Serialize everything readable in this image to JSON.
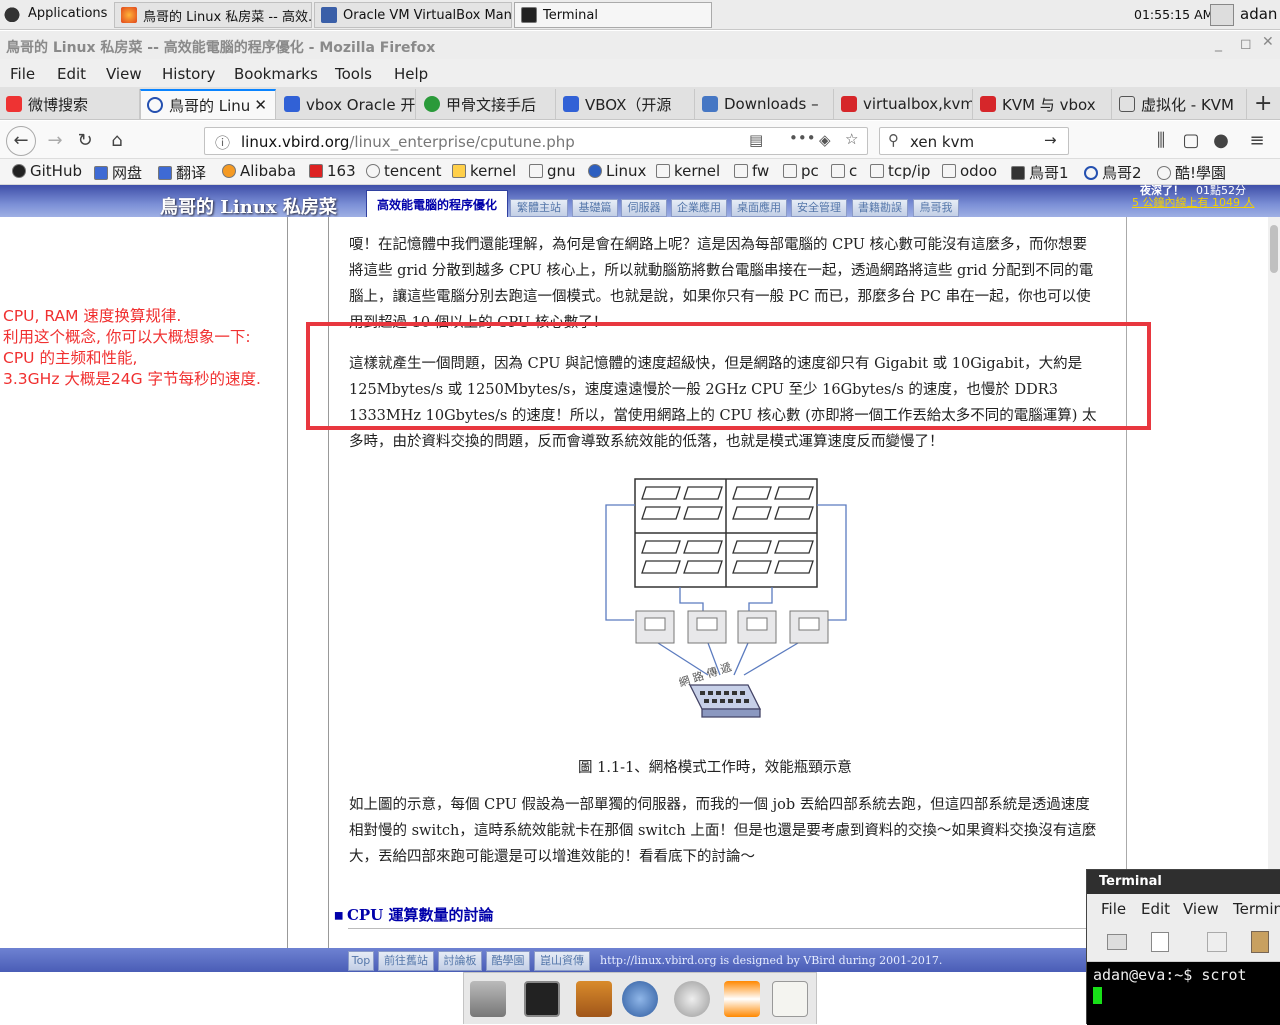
{
  "panel": {
    "apps_label": "Applications",
    "tasks": [
      "鳥哥的 Linux 私房菜 -- 高效...",
      "Oracle VM VirtualBox Mana...",
      "Terminal"
    ],
    "clock": "01:55:15 AM",
    "user": "adan"
  },
  "firefox": {
    "title": "鳥哥的 Linux 私房菜 -- 高效能電腦的程序優化 - Mozilla Firefox",
    "menu": [
      "File",
      "Edit",
      "View",
      "History",
      "Bookmarks",
      "Tools",
      "Help"
    ],
    "tabs": [
      "微博搜索",
      "鳥哥的 Linu",
      "vbox Oracle 开",
      "甲骨文接手后",
      "VBOX（开源",
      "Downloads –",
      "virtualbox,kvm",
      "KVM 与 vbox",
      "虚拟化 - KVM"
    ],
    "url_host": "linux.vbird.org",
    "url_path": "/linux_enterprise/cputune.php",
    "search_value": "xen kvm",
    "bookmarks": [
      "GitHub",
      "网盘",
      "翻译",
      "Alibaba",
      "163",
      "tencent",
      "kernel",
      "gnu",
      "Linux",
      "kernel",
      "fw",
      "pc",
      "c",
      "tcp/ip",
      "odoo",
      "鳥哥1",
      "鳥哥2",
      "酷!學園"
    ]
  },
  "site": {
    "title": "鳥哥的 Linux 私房菜",
    "active_tab": "高效能電腦的程序優化",
    "tabs": [
      "繁體主站",
      "基礎篇",
      "伺服器",
      "企業應用",
      "桌面應用",
      "安全管理",
      "書籍勘誤",
      "鳥哥我"
    ],
    "clock_line1": "夜深了！",
    "clock_time": "01點52分",
    "clock_line2": "5 公鐘內線上有 1049 人",
    "para1": "嗄！在記憶體中我們還能理解，為何是會在網路上呢？這是因為每部電腦的 CPU 核心數可能沒有這麼多，而你想要將這些 grid 分散到越多 CPU 核心上，所以就動腦筋將數台電腦串接在一起，透過網路將這些 grid 分配到不同的電腦上，讓這些電腦分別去跑這一個模式。也就是說，如果你只有一般 PC 而已，那麼多台 PC 串在一起，你也可以使用到超過 10 個以上的 CPU 核心數了！",
    "para2": "這樣就產生一個問題，因為 CPU 與記憶體的速度超級快，但是網路的速度卻只有 Gigabit 或 10Gigabit，大約是 125Mbytes/s 或 1250Mbytes/s，速度遠遠慢於一般 2GHz CPU 至少 16Gbytes/s 的速度，也慢於 DDR3 1333MHz 10Gbytes/s 的速度！所以，當使用網路上的 CPU 核心數 (亦即將一個工作丟給太多不同的電腦運算) 太多時，由於資料交換的問題，反而會導致系統效能的低落，也就是模式運算速度反而變慢了！",
    "figure_caption": "圖 1.1-1、網格模式工作時，效能瓶頸示意",
    "figure_net_label": "網 路 傳 遞",
    "para3": "如上圖的示意，每個 CPU 假設為一部單獨的伺服器，而我的一個 job 丟給四部系統去跑，但這四部系統是透過速度相對慢的 switch，這時系統效能就卡在那個 switch 上面！但是也還是要考慮到資料的交換～如果資料交換沒有這麼大，丟給四部來跑可能還是可以增進效能的！看看底下的討論～",
    "section": "CPU 運算數量的討論",
    "footer_links": [
      "Top",
      "前往舊站",
      "討論板",
      "酷學園",
      "崑山資傳"
    ],
    "credit": "http://linux.vbird.org is designed by VBird during 2001-2017."
  },
  "annotation": {
    "lines": [
      "CPU, RAM 速度换算规律.",
      "利用这个概念, 你可以大概想象一下:",
      "CPU 的主频和性能,",
      "3.3GHz 大概是24G 字节每秒的速度."
    ]
  },
  "terminal": {
    "title": "Terminal",
    "menu": [
      "File",
      "Edit",
      "View",
      "Termin"
    ],
    "prompt": "adan@eva:~$ scrot"
  }
}
